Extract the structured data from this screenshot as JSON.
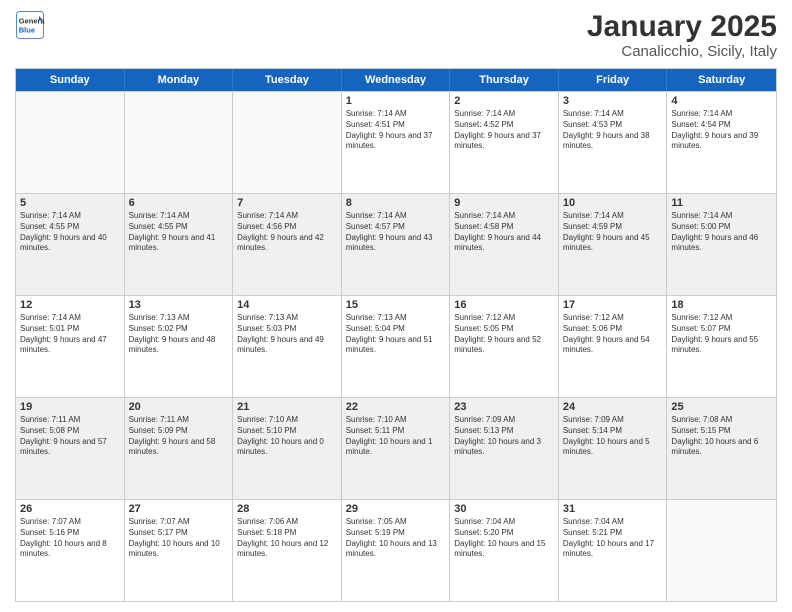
{
  "logo": {
    "general": "General",
    "blue": "Blue"
  },
  "title": "January 2025",
  "subtitle": "Canalicchio, Sicily, Italy",
  "header_days": [
    "Sunday",
    "Monday",
    "Tuesday",
    "Wednesday",
    "Thursday",
    "Friday",
    "Saturday"
  ],
  "weeks": [
    [
      {
        "day": "",
        "empty": true
      },
      {
        "day": "",
        "empty": true
      },
      {
        "day": "",
        "empty": true
      },
      {
        "day": "1",
        "sunrise": "7:14 AM",
        "sunset": "4:51 PM",
        "daylight": "9 hours and 37 minutes."
      },
      {
        "day": "2",
        "sunrise": "7:14 AM",
        "sunset": "4:52 PM",
        "daylight": "9 hours and 37 minutes."
      },
      {
        "day": "3",
        "sunrise": "7:14 AM",
        "sunset": "4:53 PM",
        "daylight": "9 hours and 38 minutes."
      },
      {
        "day": "4",
        "sunrise": "7:14 AM",
        "sunset": "4:54 PM",
        "daylight": "9 hours and 39 minutes."
      }
    ],
    [
      {
        "day": "5",
        "sunrise": "7:14 AM",
        "sunset": "4:55 PM",
        "daylight": "9 hours and 40 minutes."
      },
      {
        "day": "6",
        "sunrise": "7:14 AM",
        "sunset": "4:55 PM",
        "daylight": "9 hours and 41 minutes."
      },
      {
        "day": "7",
        "sunrise": "7:14 AM",
        "sunset": "4:56 PM",
        "daylight": "9 hours and 42 minutes."
      },
      {
        "day": "8",
        "sunrise": "7:14 AM",
        "sunset": "4:57 PM",
        "daylight": "9 hours and 43 minutes."
      },
      {
        "day": "9",
        "sunrise": "7:14 AM",
        "sunset": "4:58 PM",
        "daylight": "9 hours and 44 minutes."
      },
      {
        "day": "10",
        "sunrise": "7:14 AM",
        "sunset": "4:59 PM",
        "daylight": "9 hours and 45 minutes."
      },
      {
        "day": "11",
        "sunrise": "7:14 AM",
        "sunset": "5:00 PM",
        "daylight": "9 hours and 46 minutes."
      }
    ],
    [
      {
        "day": "12",
        "sunrise": "7:14 AM",
        "sunset": "5:01 PM",
        "daylight": "9 hours and 47 minutes."
      },
      {
        "day": "13",
        "sunrise": "7:13 AM",
        "sunset": "5:02 PM",
        "daylight": "9 hours and 48 minutes."
      },
      {
        "day": "14",
        "sunrise": "7:13 AM",
        "sunset": "5:03 PM",
        "daylight": "9 hours and 49 minutes."
      },
      {
        "day": "15",
        "sunrise": "7:13 AM",
        "sunset": "5:04 PM",
        "daylight": "9 hours and 51 minutes."
      },
      {
        "day": "16",
        "sunrise": "7:12 AM",
        "sunset": "5:05 PM",
        "daylight": "9 hours and 52 minutes."
      },
      {
        "day": "17",
        "sunrise": "7:12 AM",
        "sunset": "5:06 PM",
        "daylight": "9 hours and 54 minutes."
      },
      {
        "day": "18",
        "sunrise": "7:12 AM",
        "sunset": "5:07 PM",
        "daylight": "9 hours and 55 minutes."
      }
    ],
    [
      {
        "day": "19",
        "sunrise": "7:11 AM",
        "sunset": "5:08 PM",
        "daylight": "9 hours and 57 minutes."
      },
      {
        "day": "20",
        "sunrise": "7:11 AM",
        "sunset": "5:09 PM",
        "daylight": "9 hours and 58 minutes."
      },
      {
        "day": "21",
        "sunrise": "7:10 AM",
        "sunset": "5:10 PM",
        "daylight": "10 hours and 0 minutes."
      },
      {
        "day": "22",
        "sunrise": "7:10 AM",
        "sunset": "5:11 PM",
        "daylight": "10 hours and 1 minute."
      },
      {
        "day": "23",
        "sunrise": "7:09 AM",
        "sunset": "5:13 PM",
        "daylight": "10 hours and 3 minutes."
      },
      {
        "day": "24",
        "sunrise": "7:09 AM",
        "sunset": "5:14 PM",
        "daylight": "10 hours and 5 minutes."
      },
      {
        "day": "25",
        "sunrise": "7:08 AM",
        "sunset": "5:15 PM",
        "daylight": "10 hours and 6 minutes."
      }
    ],
    [
      {
        "day": "26",
        "sunrise": "7:07 AM",
        "sunset": "5:16 PM",
        "daylight": "10 hours and 8 minutes."
      },
      {
        "day": "27",
        "sunrise": "7:07 AM",
        "sunset": "5:17 PM",
        "daylight": "10 hours and 10 minutes."
      },
      {
        "day": "28",
        "sunrise": "7:06 AM",
        "sunset": "5:18 PM",
        "daylight": "10 hours and 12 minutes."
      },
      {
        "day": "29",
        "sunrise": "7:05 AM",
        "sunset": "5:19 PM",
        "daylight": "10 hours and 13 minutes."
      },
      {
        "day": "30",
        "sunrise": "7:04 AM",
        "sunset": "5:20 PM",
        "daylight": "10 hours and 15 minutes."
      },
      {
        "day": "31",
        "sunrise": "7:04 AM",
        "sunset": "5:21 PM",
        "daylight": "10 hours and 17 minutes."
      },
      {
        "day": "",
        "empty": true
      }
    ]
  ]
}
